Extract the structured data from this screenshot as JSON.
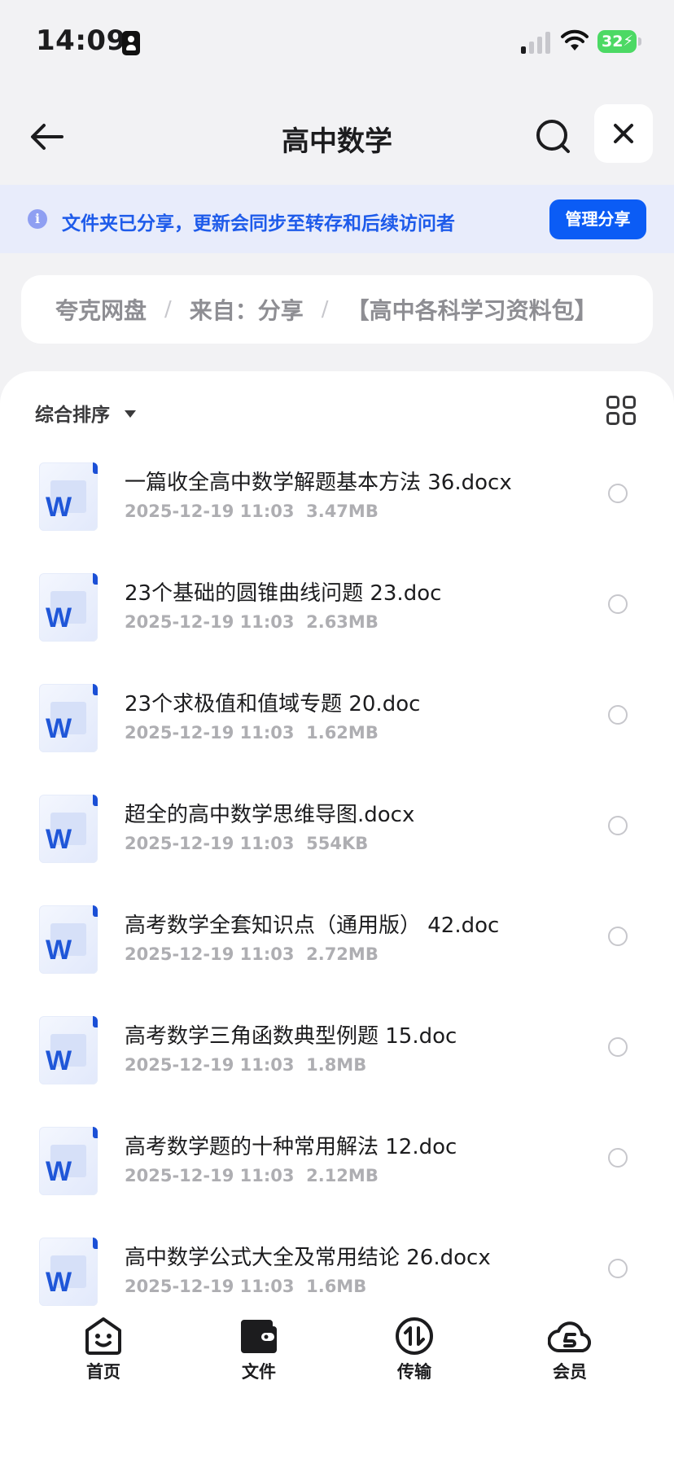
{
  "status_bar": {
    "time": "14:09",
    "battery": "32"
  },
  "nav": {
    "title": "高中数学"
  },
  "banner": {
    "text": "文件夹已分享，更新会同步至转存和后续访问者",
    "button": "管理分享"
  },
  "breadcrumb": [
    "夸克网盘",
    "来自：分享",
    "【高中各科学习资料包】"
  ],
  "sort": {
    "label": "综合排序"
  },
  "files": [
    {
      "name": "一篇收全高中数学解题基本方法 36.docx",
      "date": "2025-12-19 11:03",
      "size": "3.47MB"
    },
    {
      "name": "23个基础的圆锥曲线问题 23.doc",
      "date": "2025-12-19 11:03",
      "size": "2.63MB"
    },
    {
      "name": "23个求极值和值域专题 20.doc",
      "date": "2025-12-19 11:03",
      "size": "1.62MB"
    },
    {
      "name": "超全的高中数学思维导图.docx",
      "date": "2025-12-19 11:03",
      "size": "554KB"
    },
    {
      "name": "高考数学全套知识点（通用版） 42.doc",
      "date": "2025-12-19 11:03",
      "size": "2.72MB"
    },
    {
      "name": "高考数学三角函数典型例题  15.doc",
      "date": "2025-12-19 11:03",
      "size": "1.8MB"
    },
    {
      "name": "高考数学题的十种常用解法 12.doc",
      "date": "2025-12-19 11:03",
      "size": "2.12MB"
    },
    {
      "name": "高中数学公式大全及常用结论 26.docx",
      "date": "2025-12-19 11:03",
      "size": "1.6MB"
    }
  ],
  "tabs": [
    {
      "label": "首页",
      "icon": "home-face-icon"
    },
    {
      "label": "文件",
      "icon": "folder-icon"
    },
    {
      "label": "传输",
      "icon": "transfer-icon"
    },
    {
      "label": "会员",
      "icon": "member-cloud-icon"
    }
  ],
  "colors": {
    "accent": "#0b5cf5",
    "banner_bg": "#e8ecfb",
    "banner_text": "#1e5bea",
    "word_blue": "#1f56d8"
  }
}
